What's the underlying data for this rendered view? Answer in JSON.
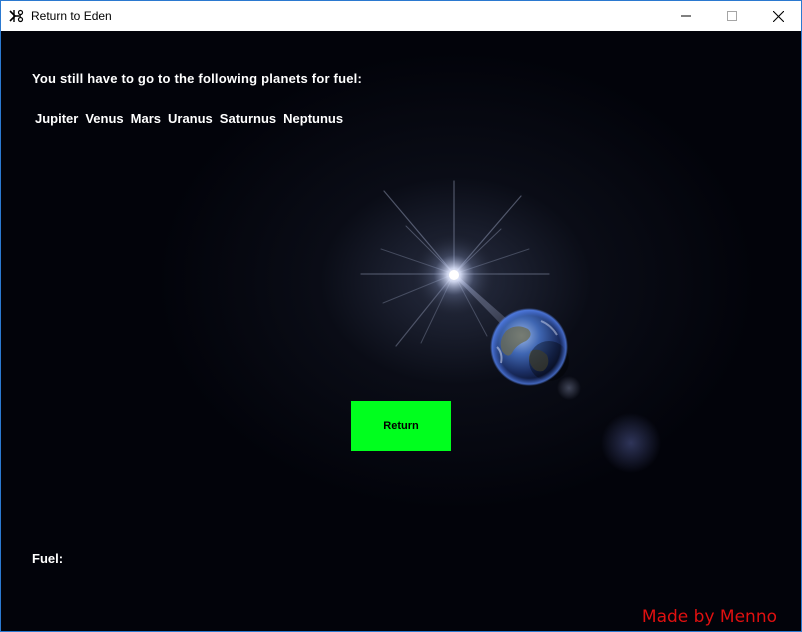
{
  "window": {
    "title": "Return to Eden",
    "icon": "app-icon",
    "controls": {
      "minimize_icon": "minimize-icon",
      "maximize_icon": "maximize-icon",
      "close_icon": "close-icon"
    }
  },
  "game": {
    "headline": "You still have to go to the following planets for fuel:",
    "planets": [
      "Jupiter",
      "Venus",
      "Mars",
      "Uranus",
      "Saturnus",
      "Neptunus"
    ],
    "return_button": "Return",
    "fuel_label": "Fuel:",
    "credit": "Made by Menno"
  },
  "colors": {
    "button": "#00ff1e",
    "credit": "#e01010",
    "text": "#ffffff",
    "background": "#02030a"
  }
}
